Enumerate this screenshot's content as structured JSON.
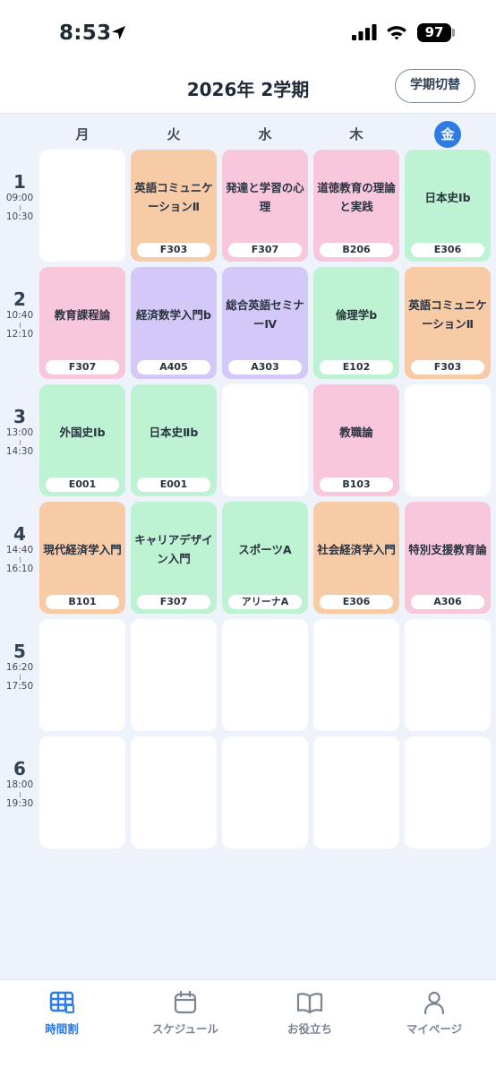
{
  "status_bar": {
    "time": "8:53",
    "battery": "97"
  },
  "header": {
    "title": "2026年 2学期",
    "term_switch_label": "学期切替"
  },
  "days": [
    "月",
    "火",
    "水",
    "木",
    "金"
  ],
  "today_index": 4,
  "periods": [
    {
      "num": "1",
      "start": "09:00",
      "end": "10:30"
    },
    {
      "num": "2",
      "start": "10:40",
      "end": "12:10"
    },
    {
      "num": "3",
      "start": "13:00",
      "end": "14:30"
    },
    {
      "num": "4",
      "start": "14:40",
      "end": "16:10"
    },
    {
      "num": "5",
      "start": "16:20",
      "end": "17:50"
    },
    {
      "num": "6",
      "start": "18:00",
      "end": "19:30"
    }
  ],
  "timetable": [
    [
      null,
      {
        "name": "英語コミュニケーションⅡ",
        "room": "F303",
        "color": "orange"
      },
      {
        "name": "発達と学習の心理",
        "room": "F307",
        "color": "pink"
      },
      {
        "name": "道徳教育の理論と実践",
        "room": "B206",
        "color": "pink"
      },
      {
        "name": "日本史Ⅰb",
        "room": "E306",
        "color": "green"
      }
    ],
    [
      {
        "name": "教育課程論",
        "room": "F307",
        "color": "pink"
      },
      {
        "name": "経済数学入門b",
        "room": "A405",
        "color": "purple"
      },
      {
        "name": "総合英語セミナーⅣ",
        "room": "A303",
        "color": "purple"
      },
      {
        "name": "倫理学b",
        "room": "E102",
        "color": "green"
      },
      {
        "name": "英語コミュニケーションⅡ",
        "room": "F303",
        "color": "orange"
      }
    ],
    [
      {
        "name": "外国史Ⅰb",
        "room": "E001",
        "color": "green"
      },
      {
        "name": "日本史Ⅱb",
        "room": "E001",
        "color": "green"
      },
      null,
      {
        "name": "教職論",
        "room": "B103",
        "color": "pink"
      },
      null
    ],
    [
      {
        "name": "現代経済学入門",
        "room": "B101",
        "color": "orange"
      },
      {
        "name": "キャリアデザイン入門",
        "room": "F307",
        "color": "green"
      },
      {
        "name": "スポーツA",
        "room": "アリーナA",
        "color": "green"
      },
      {
        "name": "社会経済学入門",
        "room": "E306",
        "color": "orange"
      },
      {
        "name": "特別支援教育論",
        "room": "A306",
        "color": "pink"
      }
    ],
    [
      null,
      null,
      null,
      null,
      null
    ],
    [
      null,
      null,
      null,
      null,
      null
    ]
  ],
  "colors": {
    "orange": "#f8cba7",
    "pink": "#f9c7dc",
    "green": "#bdf2d2",
    "purple": "#d3c8f7",
    "accent": "#2f7be5",
    "background": "#eef3fb"
  },
  "tabs": [
    {
      "label": "時間割",
      "icon": "timetable-icon",
      "active": true
    },
    {
      "label": "スケジュール",
      "icon": "calendar-icon",
      "active": false
    },
    {
      "label": "お役立ち",
      "icon": "book-icon",
      "active": false
    },
    {
      "label": "マイページ",
      "icon": "person-icon",
      "active": false
    }
  ]
}
